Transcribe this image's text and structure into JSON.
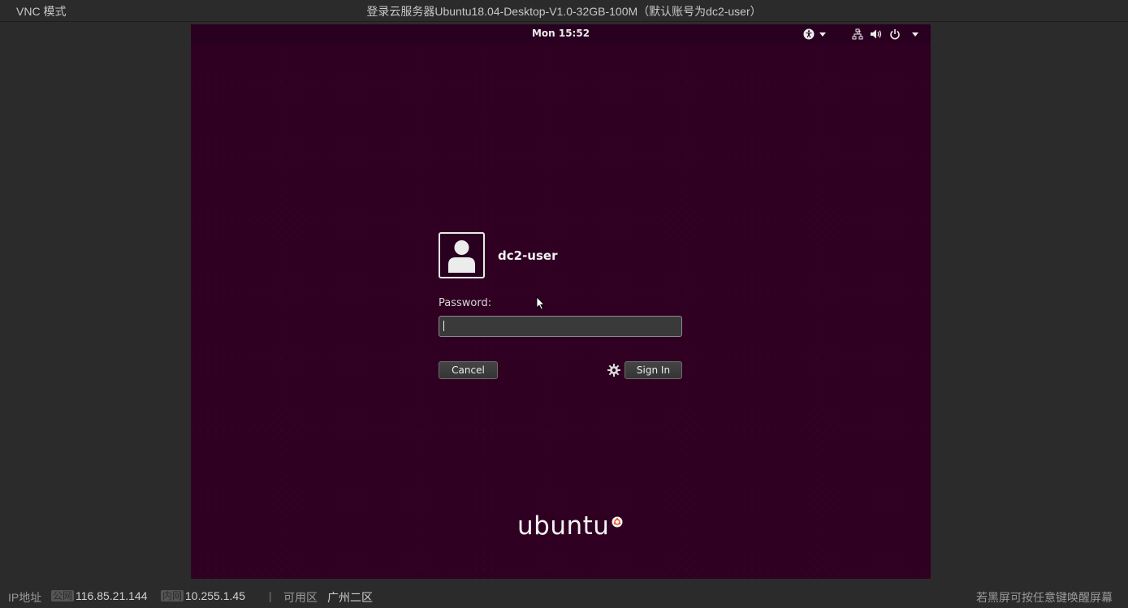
{
  "vnc": {
    "mode_label": "VNC 模式",
    "title": "登录云服务器Ubuntu18.04-Desktop-V1.0-32GB-100M（默认账号为dc2-user）"
  },
  "gnome_topbar": {
    "clock": "Mon 15:52",
    "icons": [
      "accessibility-icon",
      "network-icon",
      "volume-icon",
      "power-icon"
    ]
  },
  "login": {
    "username": "dc2-user",
    "password_label": "Password:",
    "password_value": "",
    "cancel_label": "Cancel",
    "signin_label": "Sign In"
  },
  "branding": {
    "logo_text": "ubuntu"
  },
  "status_bar": {
    "ip_label": "IP地址",
    "public_tag": "公网",
    "public_ip": "116.85.21.144",
    "private_tag": "内网",
    "private_ip": "10.255.1.45",
    "separator": "|",
    "zone_label": "可用区",
    "zone_value": "广州二区",
    "hint": "若黑屏可按任意键唤醒屏幕"
  },
  "colors": {
    "remote_bg": "#2f0022",
    "ubuntu_orange": "#e95420"
  }
}
